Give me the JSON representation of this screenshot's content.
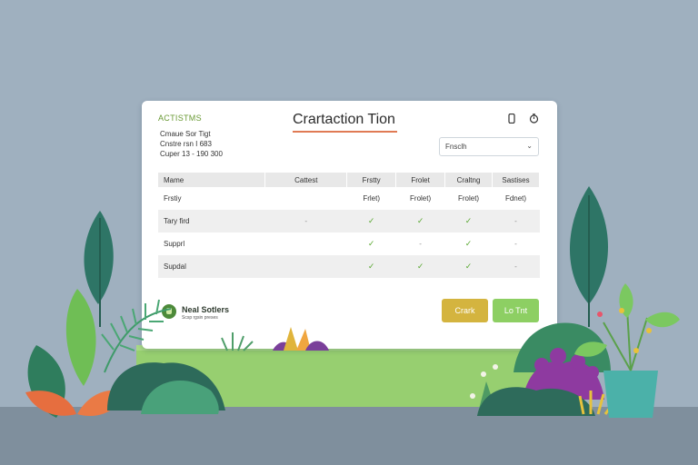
{
  "brand": "ACTISTMS",
  "meta": [
    "Cmaue Sor Tigt",
    "Cnstre rsn I 683",
    "Cuper 13 - 190 300"
  ],
  "title": "Crartaction Tion",
  "header_icons": [
    "phone-icon",
    "timer-icon"
  ],
  "filter": {
    "value": "Fnsclh",
    "icon": "chevron-down-icon"
  },
  "table": {
    "columns": [
      "Mame",
      "Cattest",
      "Frstty",
      "Frolet",
      "Craltng",
      "Sastises"
    ],
    "rows": [
      {
        "name": "Frstiy",
        "cells": [
          "",
          "Frlet)",
          "Frolet)",
          "Frolet)",
          "Fdnet)"
        ]
      },
      {
        "name": "Tary fird",
        "cells": [
          "-",
          "✓",
          "✓",
          "✓",
          "-"
        ]
      },
      {
        "name": "Supprl",
        "cells": [
          "",
          "✓",
          "-",
          "✓",
          "-"
        ]
      },
      {
        "name": "Supdal",
        "cells": [
          "",
          "✓",
          "✓",
          "✓",
          "-"
        ]
      }
    ]
  },
  "footer": {
    "logo_name": "Neal Sotlers",
    "logo_sub": "Scsp rgsin preses"
  },
  "buttons": {
    "primary": "Crark",
    "secondary": "Lo Tnt"
  },
  "colors": {
    "accent_green": "#8dcf63",
    "accent_yellow": "#d4b43f",
    "underline": "#e07a54",
    "check": "#5aa832"
  }
}
